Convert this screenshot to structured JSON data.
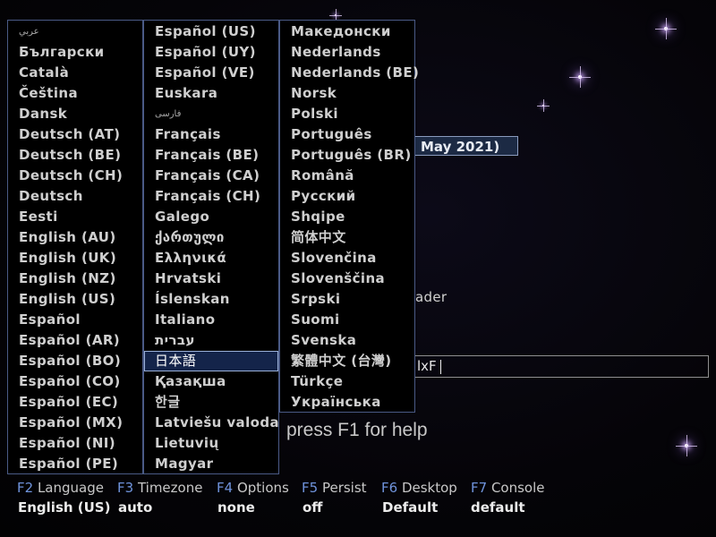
{
  "background": {
    "partial_date": "May 2021)",
    "partial_text": "ader",
    "cmdline_partial": "lxF",
    "help_text": "press F1 for help"
  },
  "columns": [
    [
      "عربي",
      "Български",
      "Català",
      "Čeština",
      "Dansk",
      "Deutsch (AT)",
      "Deutsch (BE)",
      "Deutsch (CH)",
      "Deutsch",
      "Eesti",
      "English (AU)",
      "English (UK)",
      "English (NZ)",
      "English (US)",
      "Español",
      "Español (AR)",
      "Español (BO)",
      "Español (CO)",
      "Español (EC)",
      "Español (MX)",
      "Español (NI)",
      "Español (PE)"
    ],
    [
      "Español (US)",
      "Español (UY)",
      "Español (VE)",
      "Euskara",
      "فارسی",
      "Français",
      "Français (BE)",
      "Français (CA)",
      "Français (CH)",
      "Galego",
      "ქართული",
      "Ελληνικά",
      "Hrvatski",
      "Íslenskan",
      "Italiano",
      "עברית",
      "日本語",
      "Қазақша",
      "한글",
      "Latviešu valoda",
      "Lietuvių",
      "Magyar"
    ],
    [
      "Македонски",
      "Nederlands",
      "Nederlands (BE)",
      "Norsk",
      "Polski",
      "Português",
      "Português (BR)",
      "Română",
      "Русский",
      "Shqipe",
      "简体中文",
      "Slovenčina",
      "Slovenščina",
      "Srpski",
      "Suomi",
      "Svenska",
      "繁體中文 (台灣)",
      "Türkçe",
      "Українська"
    ]
  ],
  "selected_language": "日本語",
  "function_keys": [
    {
      "key": "F2",
      "label": "Language",
      "value": "English (US)"
    },
    {
      "key": "F3",
      "label": "Timezone",
      "value": "auto"
    },
    {
      "key": "F4",
      "label": "Options",
      "value": "none"
    },
    {
      "key": "F5",
      "label": "Persist",
      "value": "off"
    },
    {
      "key": "F6",
      "label": "Desktop",
      "value": "Default"
    },
    {
      "key": "F7",
      "label": "Console",
      "value": "default"
    }
  ],
  "colors": {
    "accent": "#6f93dc",
    "selection_bg": "#14244a",
    "border": "#4a5a86"
  }
}
